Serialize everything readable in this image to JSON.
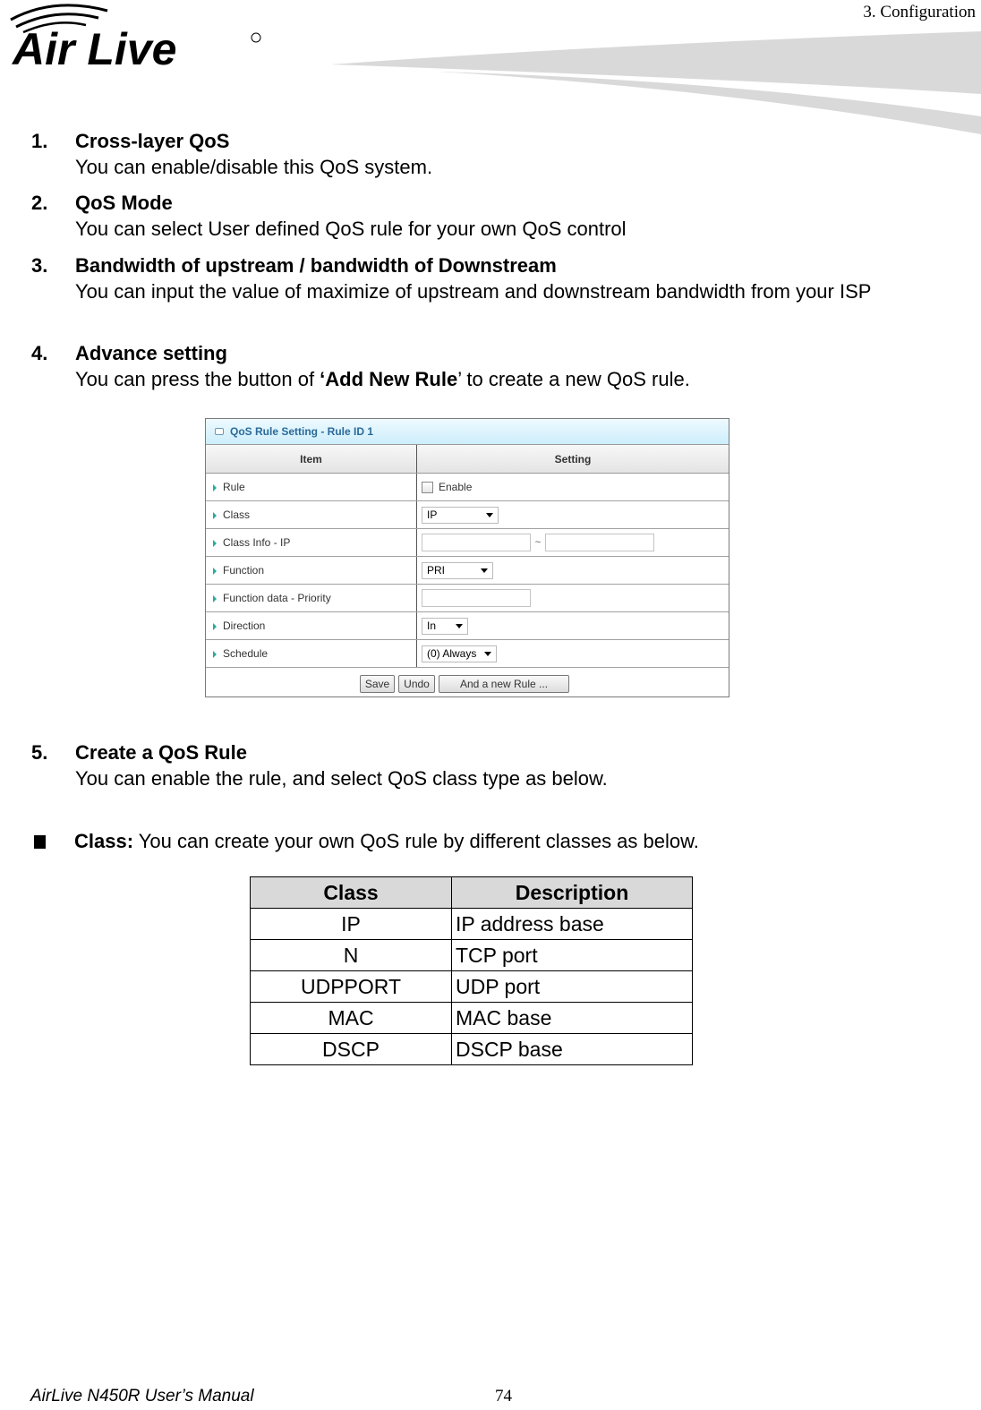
{
  "header": {
    "brand": "Air Live",
    "chapter": "3.  Configuration"
  },
  "sections": [
    {
      "num": "1.",
      "title": "Cross-layer QoS",
      "body": "You can enable/disable this QoS system."
    },
    {
      "num": "2.",
      "title": "QoS Mode",
      "body": "You can select User defined QoS rule for your own QoS control"
    },
    {
      "num": "3.",
      "title": "Bandwidth of upstream / bandwidth of Downstream",
      "body": "You can input the value of maximize of upstream and downstream bandwidth from your ISP"
    },
    {
      "num": "4.",
      "title": "Advance setting",
      "body_pre": "You can press the button of ",
      "body_bold": "‘Add New Rule",
      "body_post": "’ to create a new QoS rule."
    },
    {
      "num": "5.",
      "title": "Create a QoS Rule",
      "body": "You can enable the rule, and select QoS class type as below."
    }
  ],
  "qos_panel": {
    "title": "QoS Rule Setting - Rule ID 1",
    "col_item": "Item",
    "col_setting": "Setting",
    "rows": {
      "rule": {
        "label": "Rule",
        "checkbox_label": "Enable",
        "checked": false
      },
      "class": {
        "label": "Class",
        "value": "IP"
      },
      "class_info": {
        "label": "Class Info - IP",
        "from": "",
        "to": "",
        "separator": "~"
      },
      "function": {
        "label": "Function",
        "value": "PRI"
      },
      "function_data": {
        "label": "Function data - Priority",
        "value": ""
      },
      "direction": {
        "label": "Direction",
        "value": "In"
      },
      "schedule": {
        "label": "Schedule",
        "value": "(0) Always"
      }
    },
    "buttons": {
      "save": "Save",
      "undo": "Undo",
      "add_rule": "And a new Rule ..."
    }
  },
  "class_bullet": {
    "label": "Class:",
    "text": " You can create your own QoS rule by different classes as below."
  },
  "class_table": {
    "headers": [
      "Class",
      "Description"
    ],
    "rows": [
      [
        "IP",
        "IP address base"
      ],
      [
        "N",
        "TCP port"
      ],
      [
        "UDPPORT",
        "UDP port"
      ],
      [
        "MAC",
        "MAC base"
      ],
      [
        "DSCP",
        "DSCP base"
      ]
    ]
  },
  "footer": {
    "manual_title": "AirLive N450R User’s Manual",
    "page_number": "74"
  }
}
